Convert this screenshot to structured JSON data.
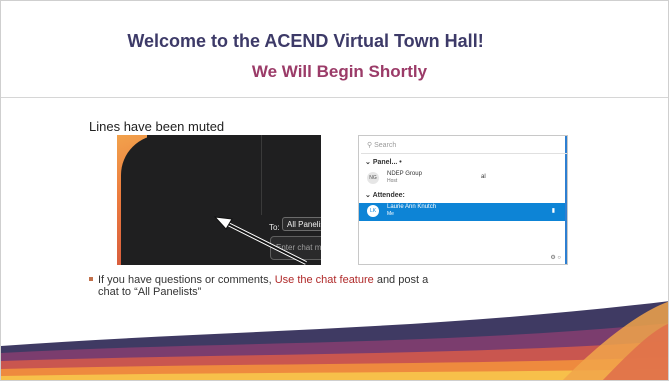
{
  "slide": {
    "title": "Welcome to the ACEND Virtual Town Hall!",
    "subtitle": "We Will Begin Shortly",
    "muted_note": "Lines have been muted"
  },
  "chat_panel": {
    "to_label": "To:",
    "recipient_value": "All Panelists",
    "input_placeholder": "Enter chat message here"
  },
  "participants_panel": {
    "search_placeholder": "Search",
    "panelists_header": "Panel... •",
    "panelist": {
      "initials": "NG",
      "name": "NDEP Group",
      "role": "Host",
      "extra": "al"
    },
    "attendee_header": "Attendee:",
    "attendee": {
      "initials": "LK",
      "name": "Laurie Ann Knutch",
      "role": "Me"
    }
  },
  "bullet": {
    "part1": "If you have questions or comments, ",
    "highlight": "Use the chat feature",
    "part2": " and post a",
    "line2": "chat to “All Panelists”"
  },
  "colors": {
    "title": "#3d3a68",
    "subtitle": "#9b3b68",
    "highlight": "#b02a2a",
    "selected_row": "#0d84d6"
  },
  "icons": [
    "chevron-down-icon",
    "send-icon",
    "search-icon",
    "mic-icon",
    "status-icons"
  ]
}
